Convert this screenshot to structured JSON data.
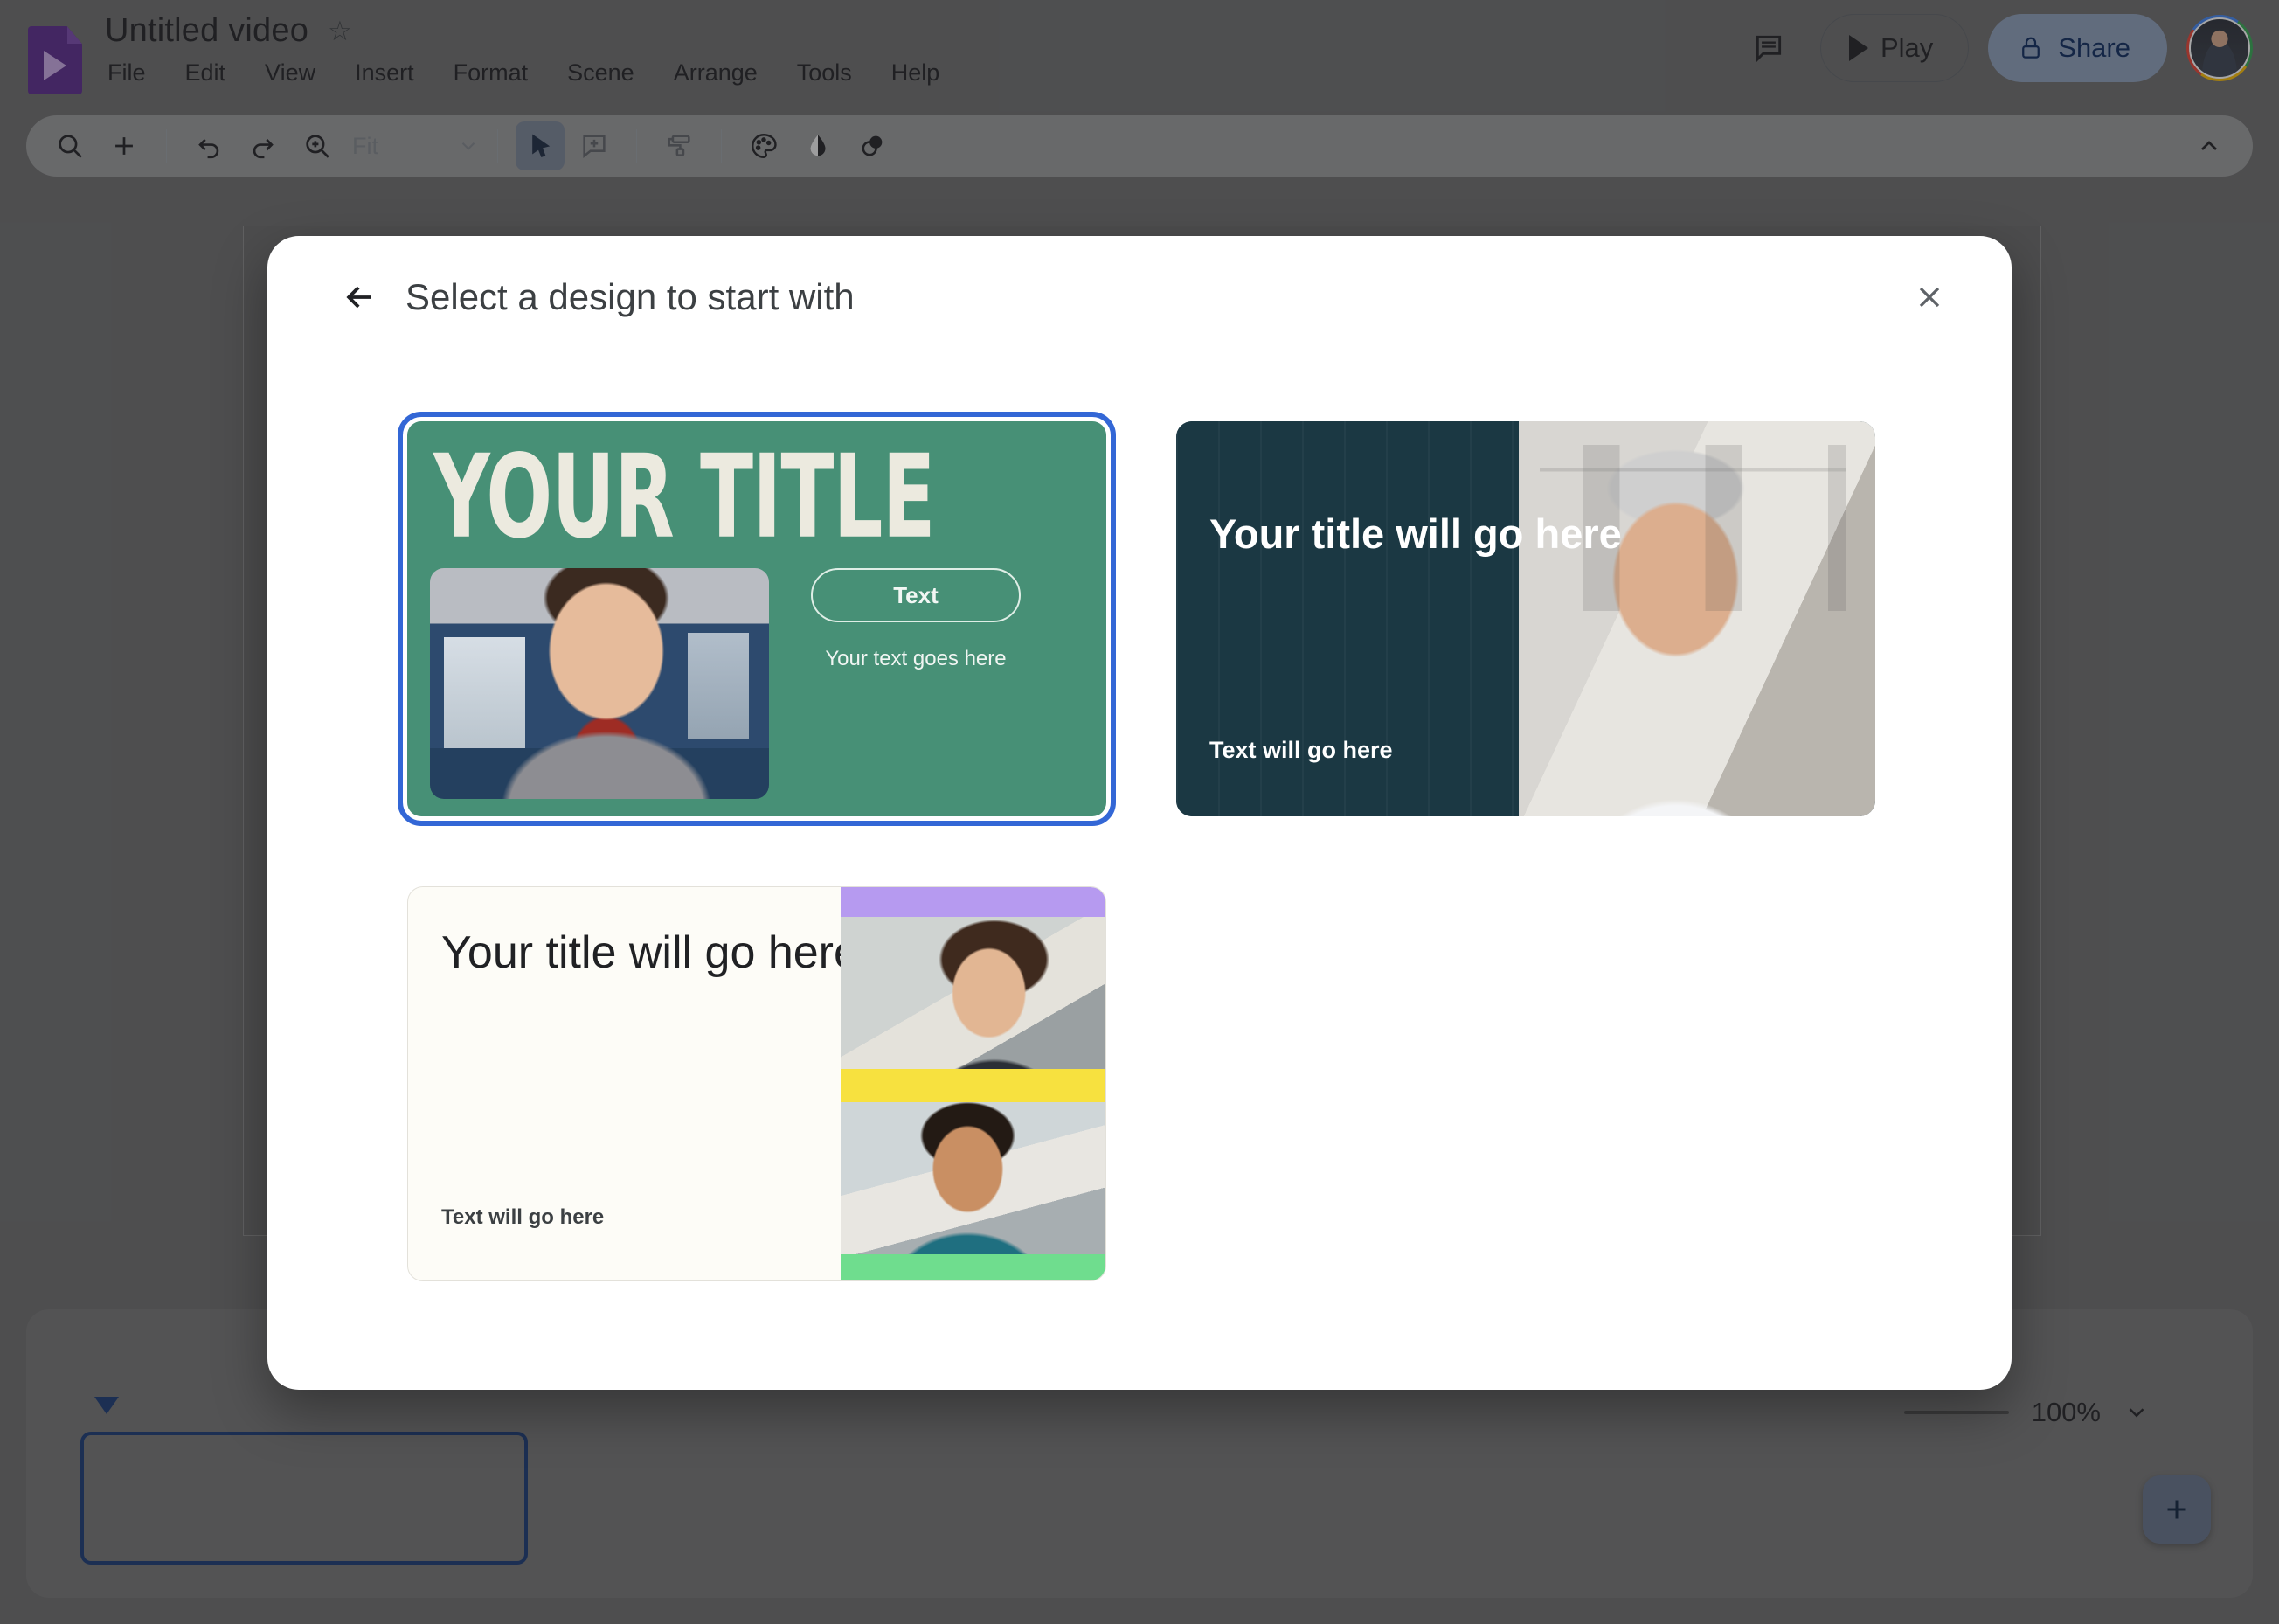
{
  "app": {
    "doc_title": "Untitled video",
    "star_icon": "star-outline-icon",
    "logo_icon": "google-vids-file-icon"
  },
  "menubar": {
    "items": [
      {
        "label": "File"
      },
      {
        "label": "Edit"
      },
      {
        "label": "View"
      },
      {
        "label": "Insert"
      },
      {
        "label": "Format"
      },
      {
        "label": "Scene"
      },
      {
        "label": "Arrange"
      },
      {
        "label": "Tools"
      },
      {
        "label": "Help"
      }
    ]
  },
  "header_actions": {
    "comment_icon": "comment-history-icon",
    "play_label": "Play",
    "play_icon": "play-triangle-icon",
    "share_label": "Share",
    "share_icon": "lock-icon",
    "avatar_name": "account-avatar"
  },
  "toolbar": {
    "search_icon": "search-icon",
    "add_icon": "plus-icon",
    "undo_icon": "undo-icon",
    "redo_icon": "redo-icon",
    "zoom_icon": "zoom-in-icon",
    "zoom_value": "Fit",
    "dropdown_icon": "chevron-down-icon",
    "select_icon": "cursor-arrow-icon",
    "comment_add_icon": "add-comment-icon",
    "format_painter_icon": "paint-roller-icon",
    "theme_icon": "palette-icon",
    "fill_icon": "water-drop-icon",
    "contrast_icon": "overlap-circles-icon",
    "collapse_icon": "chevron-up-icon"
  },
  "timeline": {
    "playhead_name": "playhead-marker",
    "clip_name": "empty-scene-clip",
    "zoom_value": "100%",
    "zoom_dropdown_icon": "chevron-down-icon",
    "add_scene_icon": "plus-icon"
  },
  "modal": {
    "title": "Select a design to start with",
    "back_icon": "arrow-left-icon",
    "close_icon": "close-x-icon",
    "templates": [
      {
        "id": "template-bold-green",
        "selected": true,
        "title": "YOUR TITLE",
        "button_label": "Text",
        "subtitle": "Your text goes here",
        "bg_color": "#479076",
        "text_color": "#eceadf"
      },
      {
        "id": "template-teal-portrait",
        "selected": false,
        "title": "Your title will go here",
        "subtitle": "Text will go here",
        "bg_color": "#1b3843",
        "text_color": "#ffffff"
      },
      {
        "id": "template-cream-duo",
        "selected": false,
        "title": "Your title will go here",
        "subtitle": "Text will go here",
        "bg_color": "#fdfcf7",
        "text_color": "#202124",
        "band_purple": "#b69af0",
        "band_yellow": "#f7e13f",
        "band_green": "#6fdd8e"
      }
    ]
  },
  "colors": {
    "accent_blue": "#3367d6",
    "app_bg": "#6d6d6d",
    "timeline_border": "#1a3a73"
  }
}
